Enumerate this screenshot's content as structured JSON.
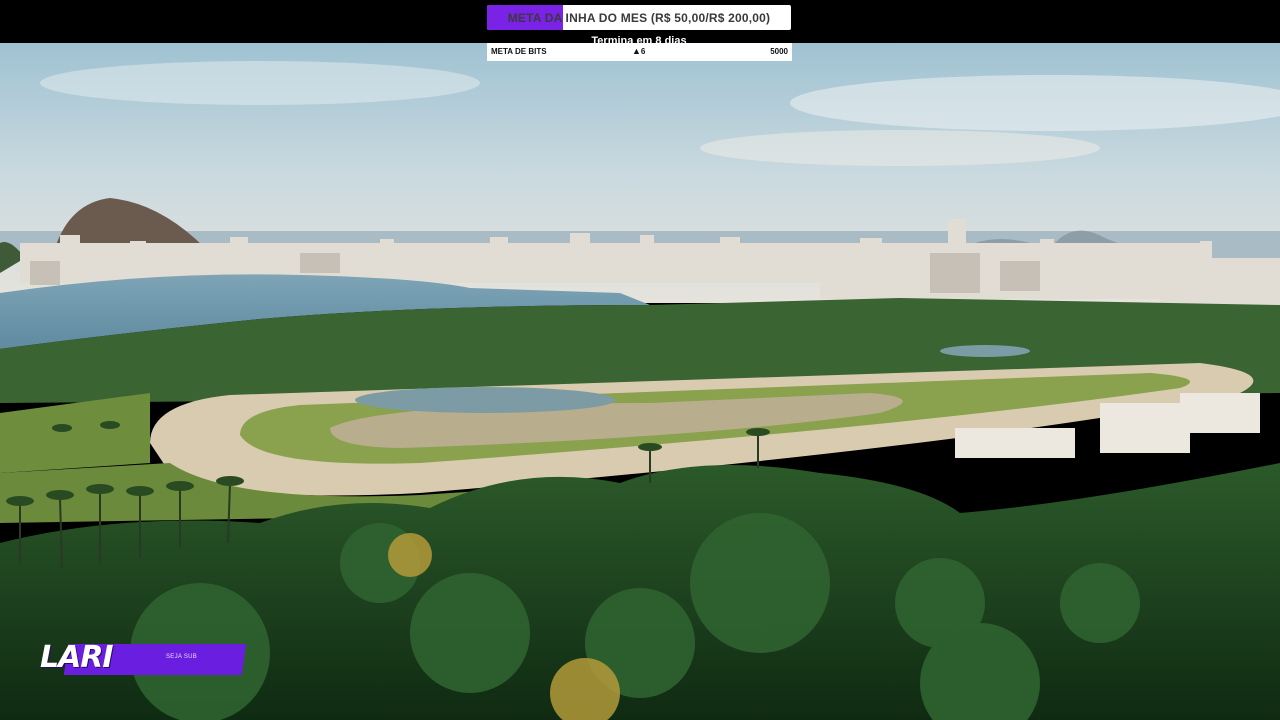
{
  "overlay": {
    "monthly_goal": {
      "label": "META DA INHA DO MES (R$ 50,00/R$ 200,00)",
      "progress_fraction": 0.25,
      "ends_text": "Termina em 8 dias"
    },
    "bits_goal": {
      "label": "META DE BITS",
      "progress_icon": "triangle-up-icon",
      "current": "6",
      "target": "5000"
    },
    "streamer_tag": {
      "name": "LARI",
      "subtitle": "SEJA SUB"
    }
  },
  "colors": {
    "accent_purple": "#7a22e6",
    "bar_background": "#ffffff",
    "frame": "#000000"
  }
}
